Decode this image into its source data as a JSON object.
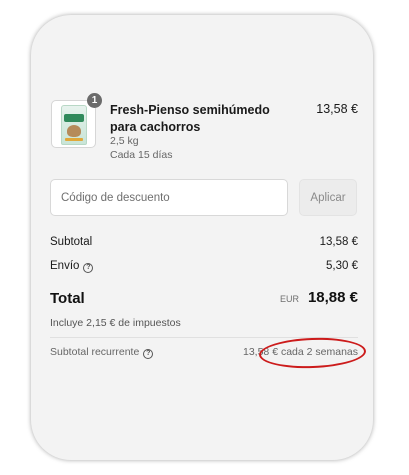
{
  "product": {
    "quantity": "1",
    "title": "Fresh-Pienso semihúmedo para cachorros",
    "weight": "2,5 kg",
    "frequency": "Cada 15 días",
    "price": "13,58 €"
  },
  "discount": {
    "placeholder": "Código de descuento",
    "apply_label": "Aplicar"
  },
  "summary": {
    "subtotal_label": "Subtotal",
    "subtotal_value": "13,58 €",
    "shipping_label": "Envío",
    "shipping_value": "5,30 €",
    "total_label": "Total",
    "total_currency": "EUR",
    "total_value": "18,88 €",
    "taxes_note": "Incluye 2,15 € de impuestos",
    "recurring_label": "Subtotal recurrente",
    "recurring_value": "13,58 € cada 2 semanas"
  },
  "icons": {
    "info": "info-circle-icon",
    "product_image": "dog-food-bag-image"
  },
  "colors": {
    "highlight": "#cc1b1b",
    "card_background": "#f3f3f3",
    "badge": "#6b6b6b"
  }
}
